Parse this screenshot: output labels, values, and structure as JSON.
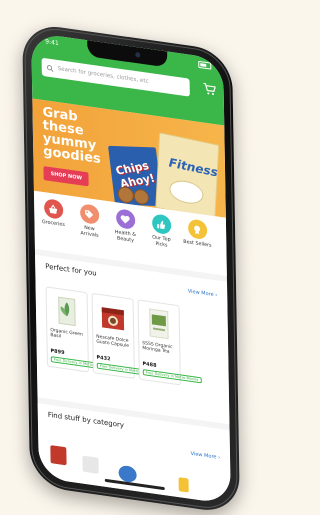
{
  "status": {
    "time": "9:41"
  },
  "search": {
    "placeholder": "Search for groceries, clothes, etc"
  },
  "banner": {
    "title": "Grab these yummy goodies",
    "button": "SHOP NOW",
    "products": [
      "Chips Ahoy!",
      "Fitness"
    ]
  },
  "categories": [
    {
      "label": "Groceries",
      "color": "#e0564f",
      "icon": "basket-icon"
    },
    {
      "label": "New Arrivals",
      "color": "#f08e6e",
      "icon": "tag-icon"
    },
    {
      "label": "Health & Beauty",
      "color": "#9b6fd6",
      "icon": "heart-icon"
    },
    {
      "label": "Our Top Picks",
      "color": "#2ec6c0",
      "icon": "thumbs-up-icon"
    },
    {
      "label": "Best Sellers",
      "color": "#f3c237",
      "icon": "badge-icon"
    }
  ],
  "perfect_for_you": {
    "title": "Perfect for you",
    "view_more": "View More",
    "products": [
      {
        "name": "Organic Green Basil",
        "price": "₱899",
        "tag": "Free Delivery in Metro Manila",
        "color": "#5a9a55"
      },
      {
        "name": "Nescafe Dolce Gusto Capsule",
        "price": "₱432",
        "tag": "Free Delivery in Metro Manila",
        "color": "#c0392b"
      },
      {
        "name": "SSSS Organic Moringa Tea",
        "price": "₱488",
        "tag": "Free Delivery in Metro Manila",
        "color": "#6f9a45"
      }
    ]
  },
  "find_by_category": {
    "title": "Find stuff by category",
    "view_more": "View More"
  },
  "colors": {
    "primary_green": "#3bb648",
    "banner_orange": "#f2a33a",
    "shop_button": "#e63d57",
    "link_blue": "#2b74c9"
  }
}
